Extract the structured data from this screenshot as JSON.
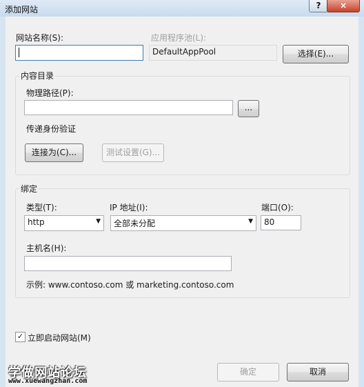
{
  "window": {
    "title": "添加网站",
    "help_label": "?",
    "close_label": "×"
  },
  "site": {
    "name_label": "网站名称(S):",
    "name_value": "",
    "app_pool_label": "应用程序池(L):",
    "app_pool_value": "DefaultAppPool",
    "select_label": "选择(E)..."
  },
  "content_dir": {
    "group_label": "内容目录",
    "physical_path_label": "物理路径(P):",
    "physical_path_value": "",
    "browse_label": "...",
    "pass_through_label": "传递身份验证",
    "connect_as_label": "连接为(C)...",
    "test_settings_label": "测试设置(G)..."
  },
  "binding": {
    "group_label": "绑定",
    "type_label": "类型(T):",
    "type_value": "http",
    "ip_label": "IP 地址(I):",
    "ip_value": "全部未分配",
    "port_label": "端口(O):",
    "port_value": "80",
    "hostname_label": "主机名(H):",
    "hostname_value": "",
    "example_text": "示例: www.contoso.com 或 marketing.contoso.com"
  },
  "start_site": {
    "label": "立即启动网站(M)",
    "checked": true,
    "check_glyph": "✓"
  },
  "footer": {
    "ok_label": "确定",
    "cancel_label": "取消"
  },
  "watermark": {
    "title": "学做网站论坛",
    "url": "www.xuewangzhan.com"
  }
}
